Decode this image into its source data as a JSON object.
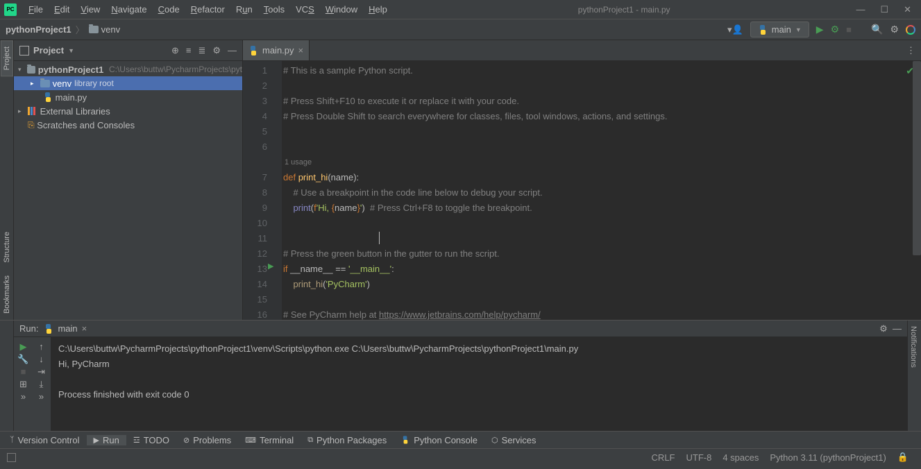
{
  "window": {
    "title": "pythonProject1 - main.py"
  },
  "menus": [
    "File",
    "Edit",
    "View",
    "Navigate",
    "Code",
    "Refactor",
    "Run",
    "Tools",
    "VCS",
    "Window",
    "Help"
  ],
  "breadcrumb": {
    "project": "pythonProject1",
    "folder": "venv"
  },
  "interpreter": {
    "name": "main"
  },
  "gutters": {
    "project": "Project",
    "structure": "Structure",
    "bookmarks": "Bookmarks",
    "notifications": "Notifications"
  },
  "projectPanel": {
    "title": "Project",
    "root": {
      "name": "pythonProject1",
      "path": "C:\\Users\\buttw\\PycharmProjects\\pyt"
    },
    "venv": {
      "name": "venv",
      "hint": "library root"
    },
    "file": {
      "name": "main.py"
    },
    "extlib": "External Libraries",
    "scratches": "Scratches and Consoles"
  },
  "editorTab": {
    "name": "main.py"
  },
  "lineNumbers": [
    "1",
    "2",
    "3",
    "4",
    "5",
    "6",
    "",
    "7",
    "8",
    "9",
    "10",
    "11",
    "12",
    "13",
    "14",
    "15",
    "16"
  ],
  "code": {
    "l1": "# This is a sample Python script.",
    "l3": "# Press Shift+F10 to execute it or replace it with your code.",
    "l4": "# Press Double Shift to search everywhere for classes, files, tool windows, actions, and settings.",
    "usage": "1 usage",
    "l7_def": "def ",
    "l7_fn": "print_hi",
    "l7_rest1": "(",
    "l7_param": "name",
    "l7_rest2": "):",
    "l8": "    # Use a breakpoint in the code line below to debug your script.",
    "l9_indent": "    ",
    "l9_fn": "print",
    "l9_p1": "(",
    "l9_f": "f",
    "l9_s1": "'Hi, ",
    "l9_b1": "{",
    "l9_nm": "name",
    "l9_b2": "}",
    "l9_s2": "'",
    "l9_p2": ")",
    "l9_cmt": "  # Press Ctrl+F8 to toggle the breakpoint.",
    "l12": "# Press the green button in the gutter to run the script.",
    "l13_if": "if ",
    "l13_name": "__name__",
    "l13_eq": " == ",
    "l13_str": "'__main__'",
    "l13_colon": ":",
    "l14_indent": "    ",
    "l14_fn": "print_hi",
    "l14_p1": "(",
    "l14_str": "'PyCharm'",
    "l14_p2": ")",
    "l16_pre": "# See PyCharm help at ",
    "l16_url": "https://www.jetbrains.com/help/pycharm/"
  },
  "runPanel": {
    "label": "Run:",
    "tab": "main",
    "output_line1": "C:\\Users\\buttw\\PycharmProjects\\pythonProject1\\venv\\Scripts\\python.exe C:\\Users\\buttw\\PycharmProjects\\pythonProject1\\main.py",
    "output_line2": "Hi, PyCharm",
    "output_line3": "Process finished with exit code 0"
  },
  "bottomBar": {
    "vc": "Version Control",
    "run": "Run",
    "todo": "TODO",
    "problems": "Problems",
    "terminal": "Terminal",
    "pkg": "Python Packages",
    "console": "Python Console",
    "services": "Services"
  },
  "statusBar": {
    "crlf": "CRLF",
    "enc": "UTF-8",
    "indent": "4 spaces",
    "py": "Python 3.11 (pythonProject1)"
  }
}
